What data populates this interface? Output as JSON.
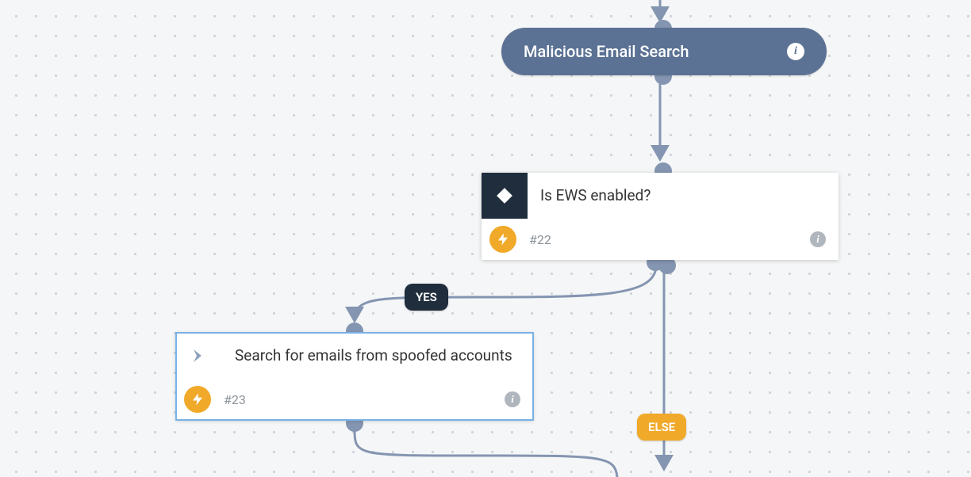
{
  "canvas": {
    "header": {
      "title": "Malicious Email Search"
    },
    "nodes": {
      "decision": {
        "title": "Is EWS enabled?",
        "id": "#22"
      },
      "action": {
        "title": "Search for emails from spoofed accounts",
        "id": "#23"
      }
    },
    "branches": {
      "yes_label": "YES",
      "else_label": "ELSE"
    }
  }
}
